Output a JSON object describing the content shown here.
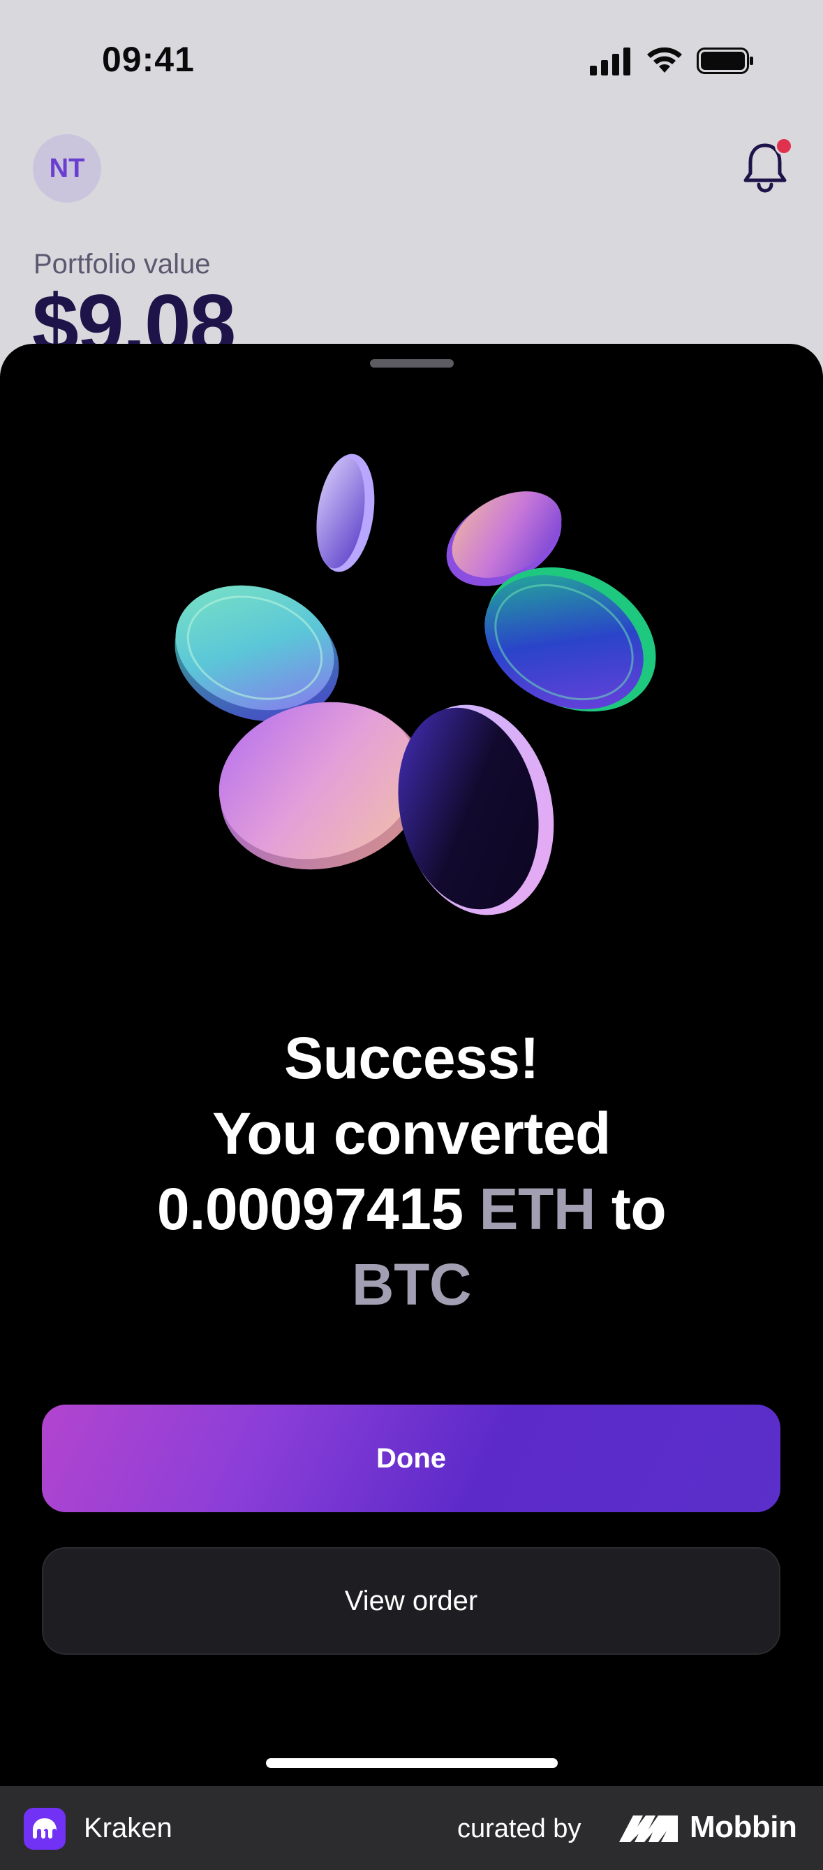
{
  "status_bar": {
    "time": "09:41"
  },
  "background_app": {
    "avatar_initials": "NT",
    "portfolio_label": "Portfolio value",
    "portfolio_value": "$9.08"
  },
  "success_sheet": {
    "title": "Success!",
    "line_converted": "You converted",
    "amount": "0.00097415",
    "from_asset": "ETH",
    "to_word": "to",
    "to_asset": "BTC",
    "done_label": "Done",
    "view_order_label": "View order"
  },
  "footer": {
    "app_name": "Kraken",
    "curated_by": "curated by",
    "brand": "Mobbin"
  },
  "colors": {
    "accent_purple": "#5c2ac9",
    "accent_pink": "#b245cf",
    "asset_gray": "#a29fb3",
    "notification_red": "#e0324e"
  }
}
